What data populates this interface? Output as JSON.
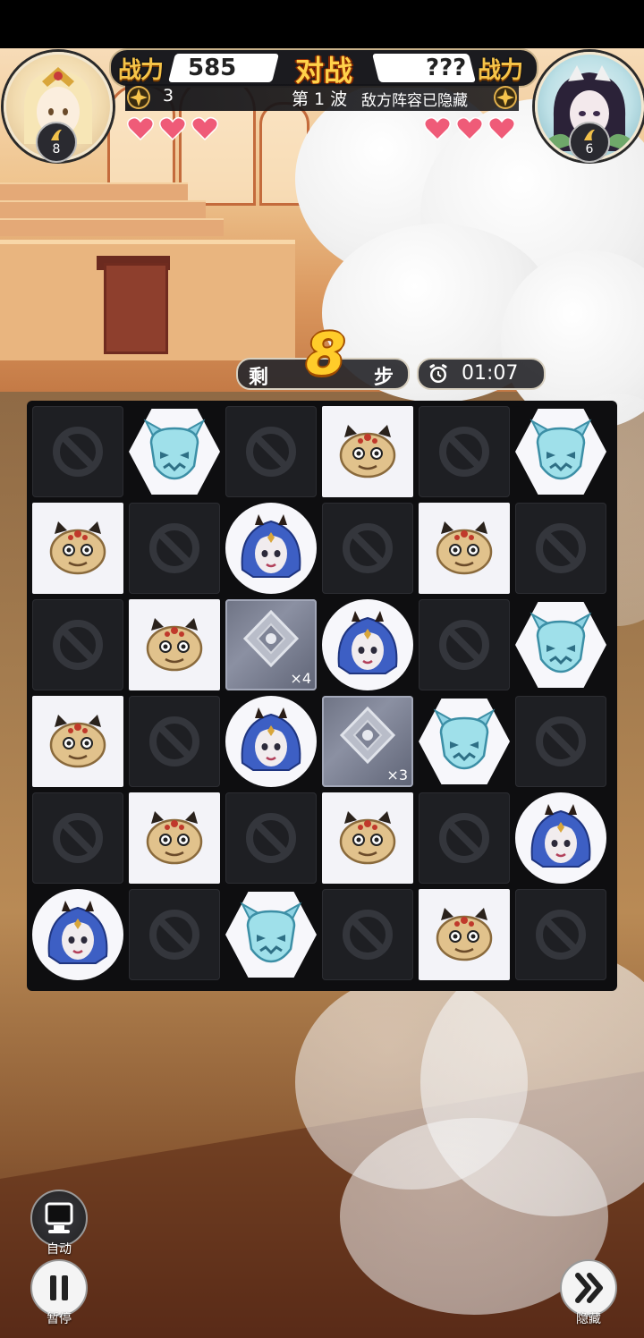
{
  "hud": {
    "player_power_label": "战力",
    "player_power_value": "585",
    "vs_label": "对战",
    "enemy_power_value": "???",
    "enemy_power_label": "战力",
    "player_star_count": "3",
    "wave_label": "第 1 波",
    "enemy_hidden_text": "敌方阵容已隐藏"
  },
  "player": {
    "level": "8",
    "hearts": 3
  },
  "enemy": {
    "level": "6",
    "hearts": 3
  },
  "steps": {
    "prefix": "剩",
    "count": "8",
    "suffix": "步"
  },
  "timer": {
    "value": "01:07"
  },
  "board": {
    "rows": 6,
    "cols": 6,
    "cells": [
      [
        "blocked",
        "dragon-hex",
        "blocked",
        "toad-square",
        "blocked",
        "dragon-hex"
      ],
      [
        "toad-square",
        "blocked",
        "girl-circle",
        "blocked",
        "toad-square",
        "blocked"
      ],
      [
        "blocked",
        "toad-square",
        "stone",
        "girl-circle",
        "blocked",
        "dragon-hex"
      ],
      [
        "toad-square",
        "blocked",
        "girl-circle",
        "stone",
        "dragon-hex",
        "blocked"
      ],
      [
        "blocked",
        "toad-square",
        "blocked",
        "toad-square",
        "blocked",
        "girl-circle"
      ],
      [
        "girl-circle",
        "blocked",
        "dragon-hex",
        "blocked",
        "toad-square",
        "blocked"
      ]
    ],
    "stone_counts": [
      {
        "row": 2,
        "col": 2,
        "label": "×4"
      },
      {
        "row": 3,
        "col": 3,
        "label": "×3"
      }
    ]
  },
  "controls": {
    "auto_label": "自动",
    "pause_label": "暂停",
    "hide_label": "隐藏"
  },
  "colors": {
    "gold": "#f5c449",
    "heart": "#ef5b78",
    "board_bg": "#0e0e10"
  }
}
